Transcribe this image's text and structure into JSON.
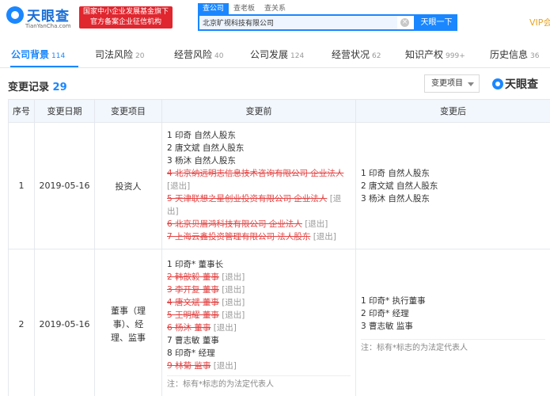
{
  "header": {
    "logo_text": "天眼查",
    "logo_sub": "TianYanCha.com",
    "banner_line1": "国家中小企业发展基金旗下",
    "banner_line2": "官方备案企业征信机构",
    "search_tabs": [
      "查公司",
      "查老板",
      "查关系"
    ],
    "search_value": "北京旷视科技有限公司",
    "search_button": "天眼一下",
    "vip_label": "VIP会"
  },
  "nav": [
    {
      "label": "公司背景",
      "count": "114",
      "active": true
    },
    {
      "label": "司法风险",
      "count": "20"
    },
    {
      "label": "经营风险",
      "count": "40"
    },
    {
      "label": "公司发展",
      "count": "124"
    },
    {
      "label": "经营状况",
      "count": "62"
    },
    {
      "label": "知识产权",
      "count": "999+"
    },
    {
      "label": "历史信息",
      "count": "36"
    }
  ],
  "section": {
    "title": "变更记录",
    "count": "29",
    "filter_label": "变更项目",
    "brand": "天眼查"
  },
  "table": {
    "headers": [
      "序号",
      "变更日期",
      "变更项目",
      "变更前",
      "变更后"
    ],
    "rows": [
      {
        "index": "1",
        "date": "2019-05-16",
        "item": "投资人",
        "before": [
          {
            "text": "1 印奇 自然人股东",
            "deleted": false
          },
          {
            "text": "2 唐文斌 自然人股东",
            "deleted": false
          },
          {
            "text": "3 杨沐 自然人股东",
            "deleted": false
          },
          {
            "text": "4 北京纳远明志信息技术咨询有限公司 企业法人",
            "tag": "[退出]",
            "deleted": true
          },
          {
            "text": "5 天津联想之星创业投资有限公司 企业法人",
            "tag": "[退出]",
            "deleted": true
          },
          {
            "text": "6 北京贝眉鸿科技有限公司 企业法人",
            "tag": "[退出]",
            "deleted": true
          },
          {
            "text": "7 上海云鑫投资管理有限公司 法人股东",
            "tag": "[退出]",
            "deleted": true
          }
        ],
        "after": [
          "1 印奇 自然人股东",
          "2 唐文斌 自然人股东",
          "3 杨沐 自然人股东"
        ]
      },
      {
        "index": "2",
        "date": "2019-05-16",
        "item": "董事（理事）、经理、监事",
        "before": [
          {
            "text": "1 印奇* 董事长",
            "deleted": false
          },
          {
            "text": "2 韩歆毅 董事",
            "tag": "[退出]",
            "deleted": true
          },
          {
            "text": "3 李开复 董事",
            "tag": "[退出]",
            "deleted": true
          },
          {
            "text": "4 唐文斌 董事",
            "tag": "[退出]",
            "deleted": true
          },
          {
            "text": "5 王明耀 董事",
            "tag": "[退出]",
            "deleted": true
          },
          {
            "text": "6 杨沐 董事",
            "tag": "[退出]",
            "deleted": true
          },
          {
            "text": "7 曹志敏 董事",
            "deleted": false
          },
          {
            "text": "8 印奇* 经理",
            "deleted": false
          },
          {
            "text": "9 林菊 监事",
            "tag": "[退出]",
            "deleted": true
          }
        ],
        "before_note": "注：标有*标志的为法定代表人",
        "after": [
          "1 印奇* 执行董事",
          "2 印奇* 经理",
          "3 曹志敏 监事"
        ],
        "after_note": "注：标有*标志的为法定代表人"
      }
    ]
  },
  "colors": {
    "accent": "#1a87ff",
    "banner": "#e0262e",
    "deleted": "#e34545",
    "vip": "#e8a321"
  },
  "icons": {
    "logo": "eye-logo-icon",
    "clear": "clear-x-icon",
    "filter_caret": "caret-down-icon"
  }
}
